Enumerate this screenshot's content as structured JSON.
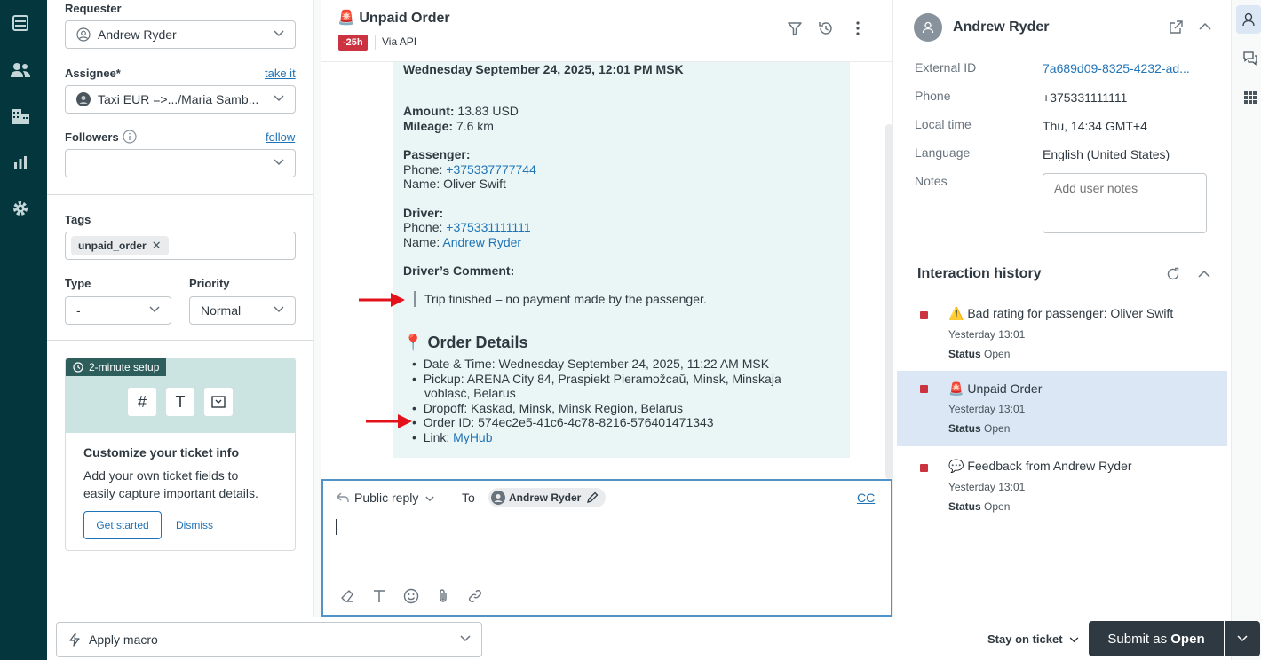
{
  "props": {
    "requester_label": "Requester",
    "requester_value": "Andrew Ryder",
    "assignee_label": "Assignee*",
    "assignee_link": "take it",
    "assignee_value": "Taxi EUR =>.../Maria Samb...",
    "followers_label": "Followers",
    "followers_link": "follow",
    "tags_label": "Tags",
    "tag": "unpaid_order",
    "type_label": "Type",
    "type_value": "-",
    "priority_label": "Priority",
    "priority_value": "Normal",
    "setup": {
      "badge": "2-minute setup",
      "title": "Customize your ticket info",
      "desc_line1": "Add your own ticket fields to",
      "desc_line2": "easily capture important details.",
      "get_started": "Get started",
      "dismiss": "Dismiss"
    }
  },
  "ticket": {
    "title": "Unpaid Order",
    "title_emoji": "🚨",
    "sla_badge": "-25h",
    "channel": "Via API"
  },
  "message": {
    "date_line": "Wednesday September 24, 2025, 12:01 PM MSK",
    "amount_label": "Amount:",
    "amount_value": " 13.83 USD",
    "mileage_label": "Mileage:",
    "mileage_value": " 7.6 km",
    "passenger_label": "Passenger:",
    "passenger_phone_label": "Phone: ",
    "passenger_phone": "+375337777744",
    "passenger_name_label": "Name: ",
    "passenger_name": "Oliver Swift",
    "driver_label": "Driver:",
    "driver_phone_label": "Phone: ",
    "driver_phone": "+375331111111",
    "driver_name_label": "Name: ",
    "driver_name": "Andrew Ryder",
    "comment_label": "Driver’s Comment:",
    "comment": "Trip finished – no payment made by the passenger.",
    "order_details_emoji": "📍",
    "order_details_title": "Order Details",
    "details": {
      "datetime": "Date & Time: Wednesday September 24, 2025, 11:22 AM MSK",
      "pickup_line1": "Pickup: ARENA City 84, Praspiekt Pieramožcaŭ, Minsk, Minskaja",
      "pickup_line2": "voblasć, Belarus",
      "dropoff": "Dropoff: Kaskad, Minsk, Minsk Region, Belarus",
      "order_id": "Order ID: 574ec2e5-41c6-4c78-8216-576401471343",
      "link_label": "Link: ",
      "link_text": "MyHub"
    }
  },
  "reply": {
    "mode": "Public reply",
    "to_label": "To",
    "recipient": "Andrew Ryder",
    "cc": "CC"
  },
  "user": {
    "name": "Andrew Ryder",
    "external_id_label": "External ID",
    "external_id": "7a689d09-8325-4232-ad...",
    "phone_label": "Phone",
    "phone": "+375331111111",
    "local_time_label": "Local time",
    "local_time": "Thu, 14:34 GMT+4",
    "language_label": "Language",
    "language": "English (United States)",
    "notes_label": "Notes",
    "notes_placeholder": "Add user notes"
  },
  "history": {
    "title": "Interaction history",
    "items": [
      {
        "emoji": "⚠️",
        "title": "Bad rating for passenger: Oliver Swift",
        "time": "Yesterday 13:01",
        "status_label": "Status",
        "status": "Open"
      },
      {
        "emoji": "🚨",
        "title": "Unpaid Order",
        "time": "Yesterday 13:01",
        "status_label": "Status",
        "status": "Open"
      },
      {
        "emoji": "💬",
        "title": "Feedback from Andrew Ryder",
        "time": "Yesterday 13:01",
        "status_label": "Status",
        "status": "Open"
      }
    ]
  },
  "footer": {
    "apply_macro": "Apply macro",
    "stay_on_ticket": "Stay on ticket",
    "submit_prefix": "Submit as ",
    "submit_status": "Open"
  },
  "colors": {
    "nav_bg": "#03363d",
    "message_bg": "#e9f6f5",
    "link": "#1f73b7",
    "sla_badge": "#cc3340",
    "submit_bg": "#2f3941",
    "selected_history_bg": "#dbe7f4",
    "arrow": "#e3111a"
  }
}
